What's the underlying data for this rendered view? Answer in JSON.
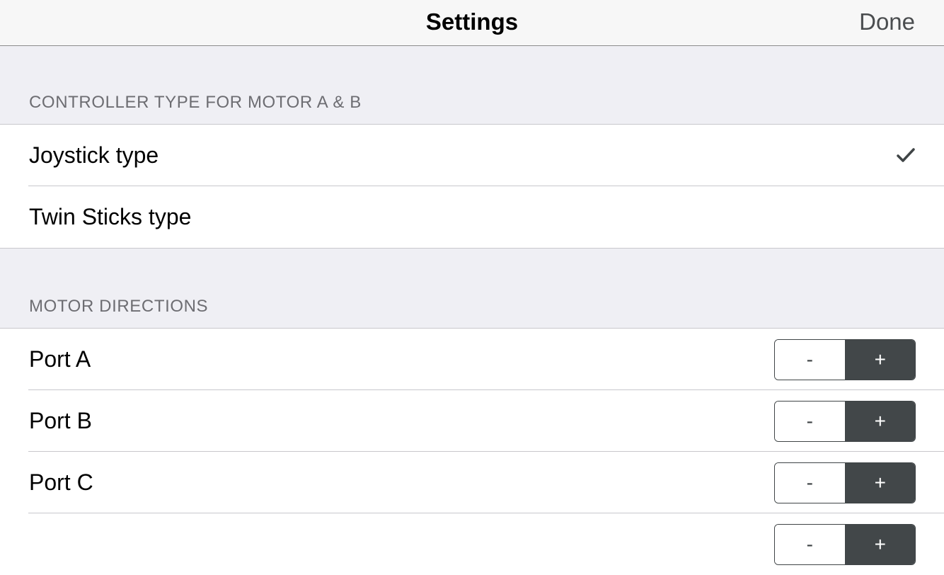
{
  "nav": {
    "title": "Settings",
    "done_label": "Done"
  },
  "controller_section": {
    "header": "CONTROLLER TYPE FOR MOTOR A & B",
    "options": [
      {
        "label": "Joystick type",
        "selected": true
      },
      {
        "label": "Twin Sticks type",
        "selected": false
      }
    ],
    "check_icon": "checkmark-icon"
  },
  "motor_section": {
    "header": "MOTOR DIRECTIONS",
    "ports": [
      {
        "label": "Port A",
        "minus": "-",
        "plus": "+",
        "selected": "+"
      },
      {
        "label": "Port B",
        "minus": "-",
        "plus": "+",
        "selected": "+"
      },
      {
        "label": "Port C",
        "minus": "-",
        "plus": "+",
        "selected": "+"
      },
      {
        "label": "",
        "minus": "-",
        "plus": "+",
        "selected": "+"
      }
    ]
  },
  "colors": {
    "accent": "#424749",
    "background": "#efeff4",
    "separator": "#c8c7cc",
    "header_text": "#6d6d72"
  }
}
